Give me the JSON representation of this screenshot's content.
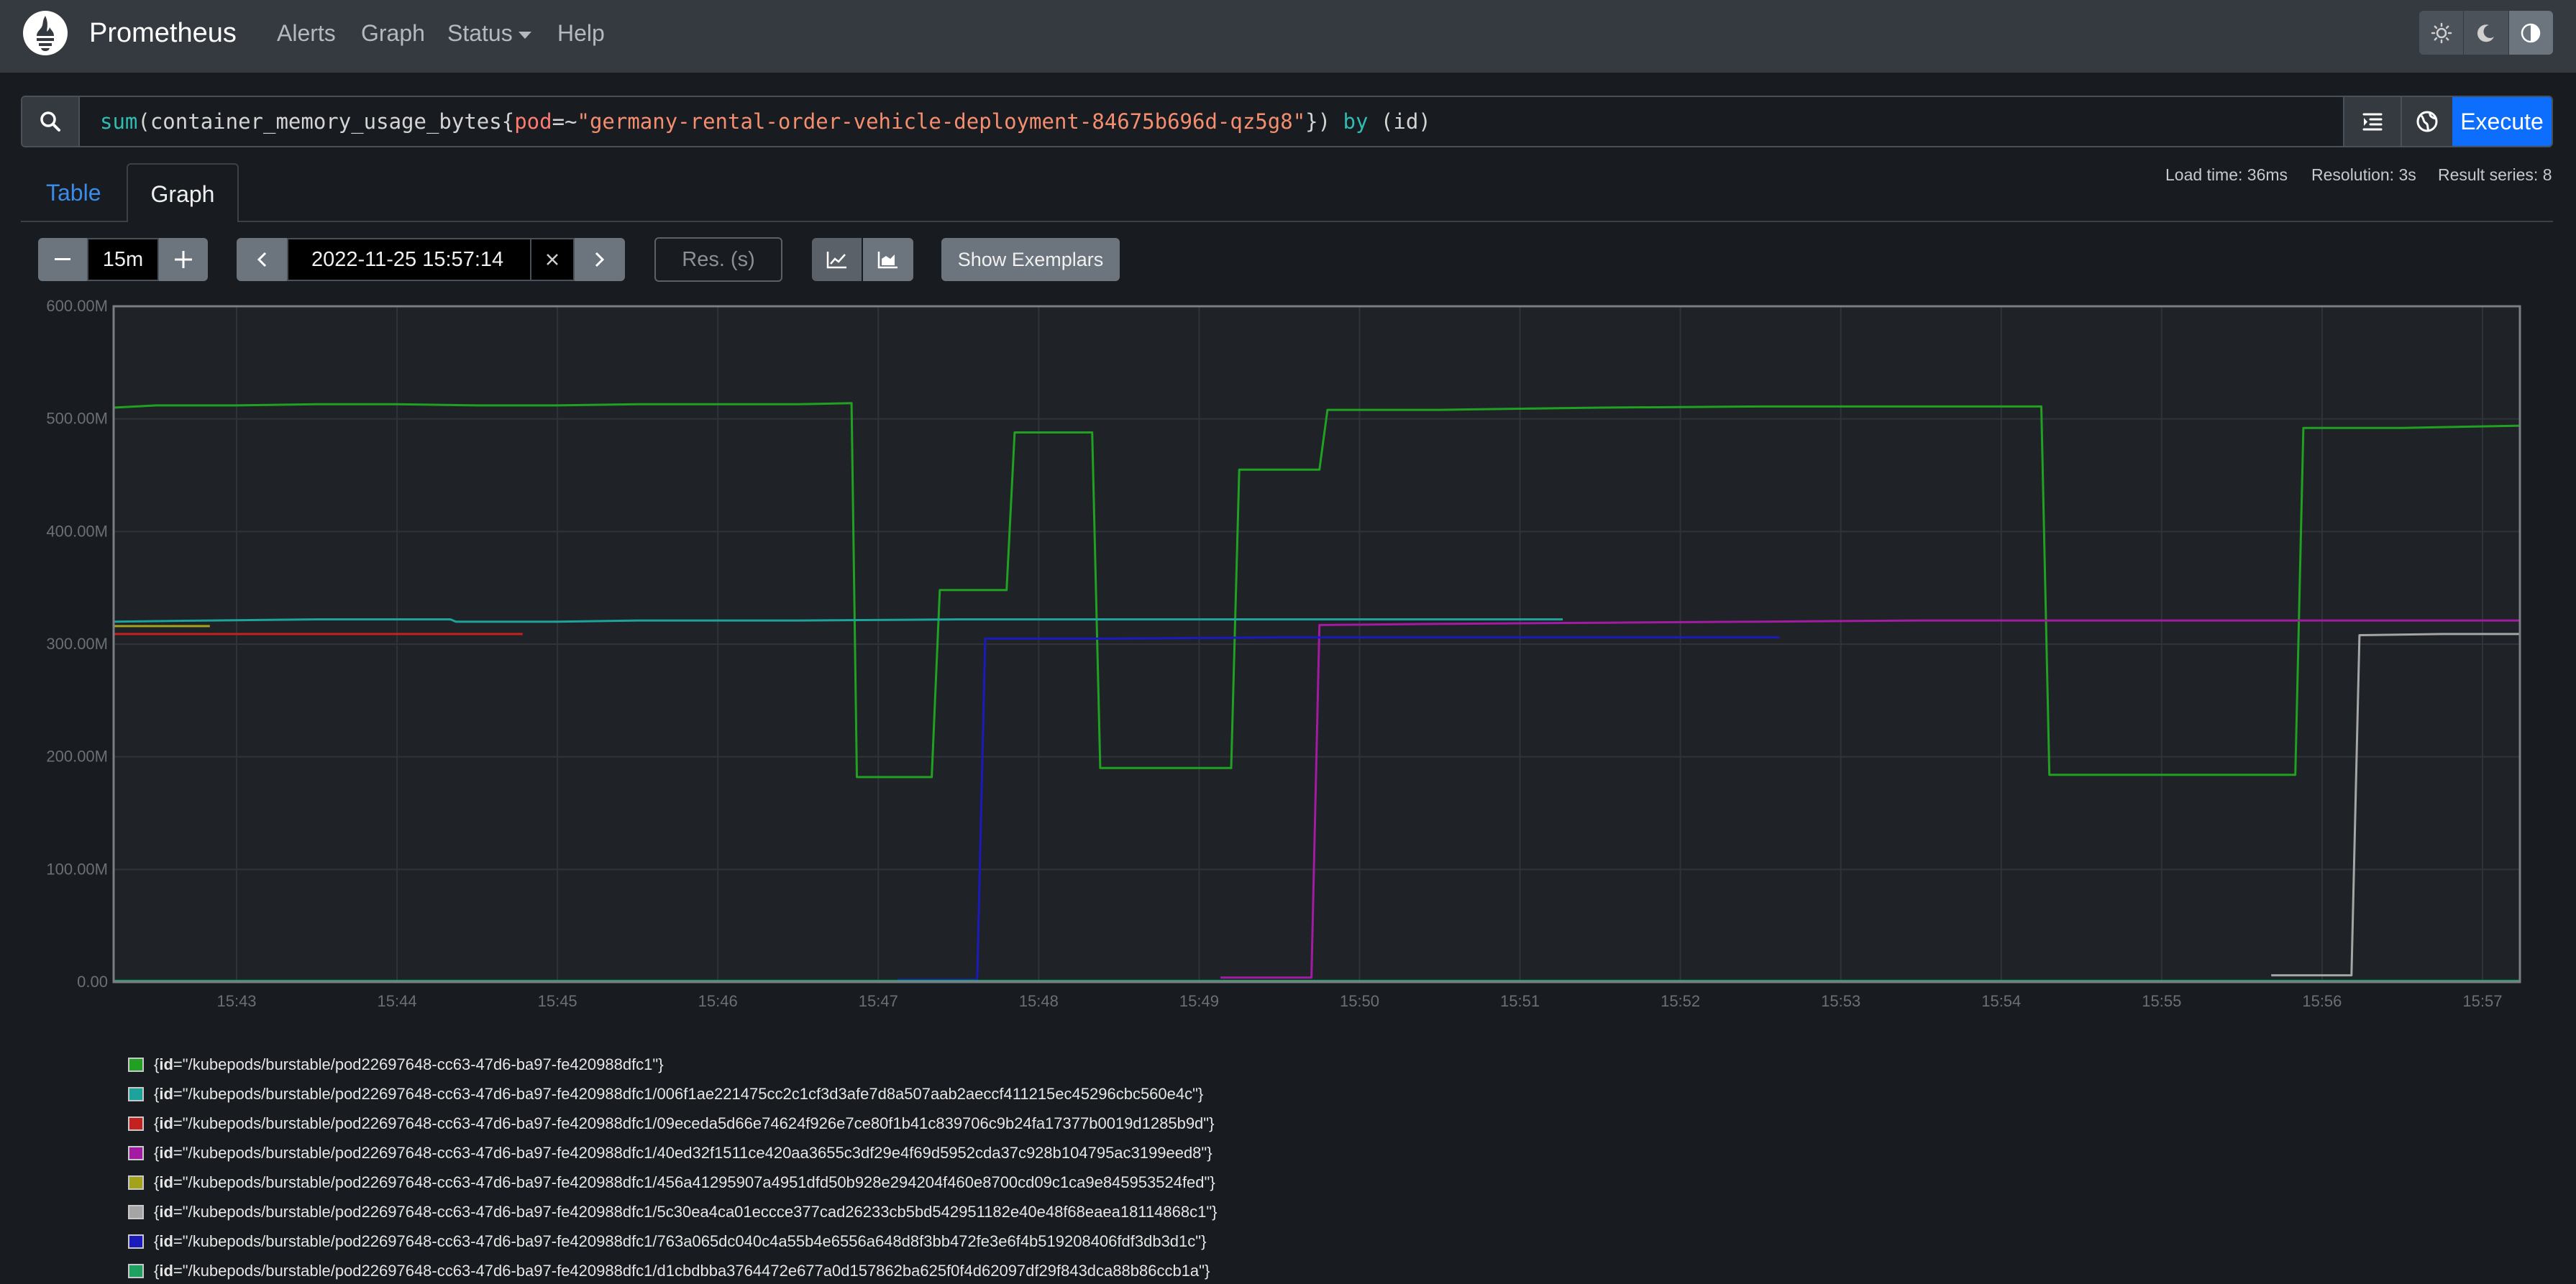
{
  "navbar": {
    "brand": "Prometheus",
    "links": [
      "Alerts",
      "Graph",
      "Status",
      "Help"
    ]
  },
  "query": {
    "expression": "sum(container_memory_usage_bytes{pod=~\"germany-rental-order-vehicle-deployment-84675b696d-qz5g8\"}) by (id)",
    "tokens": {
      "fn": "sum",
      "p1": "(container_memory_usage_bytes{",
      "label": "pod",
      "op": "=~",
      "str": "\"germany-rental-order-vehicle-deployment-84675b696d-qz5g8\"",
      "p2": "}) ",
      "kw": "by",
      "p3": " (id)"
    },
    "execute_label": "Execute"
  },
  "tabs": {
    "table": "Table",
    "graph": "Graph"
  },
  "stats": {
    "load_time": "Load time: 36ms",
    "resolution": "Resolution: 3s",
    "result_series": "Result series: 8"
  },
  "controls": {
    "range": "15m",
    "end_time": "2022-11-25 15:57:14",
    "resolution_placeholder": "Res. (s)",
    "exemplars_label": "Show Exemplars"
  },
  "icons": {
    "theme": [
      "sun-icon",
      "moon-icon",
      "contrast-icon"
    ],
    "query": [
      "search-icon",
      "format-icon",
      "globe-icon"
    ],
    "controls": [
      "minus-icon",
      "plus-icon",
      "chevron-left-icon",
      "close-icon",
      "chevron-right-icon",
      "line-chart-icon",
      "stacked-chart-icon"
    ]
  },
  "chart_data": {
    "type": "line",
    "ylabel": "",
    "xlabel": "",
    "y_ticks": [
      "0.00",
      "100.00M",
      "200.00M",
      "300.00M",
      "400.00M",
      "500.00M",
      "600.00M"
    ],
    "ylim": [
      0,
      600
    ],
    "y_unit": "M",
    "x_ticks": [
      "15:43",
      "15:44",
      "15:45",
      "15:46",
      "15:47",
      "15:48",
      "15:49",
      "15:50",
      "15:51",
      "15:52",
      "15:53",
      "15:54",
      "15:55",
      "15:56",
      "15:57"
    ],
    "xlim": [
      "15:42:14",
      "15:57:14"
    ],
    "grid": true,
    "series": [
      {
        "name": "{id=\"/kubepods/burstable/pod22697648-cc63-47d6-ba97-fe420988dfc1\"}",
        "color": "#21a121",
        "points": [
          [
            "15:42:14",
            510
          ],
          [
            "15:42:30",
            512
          ],
          [
            "15:43:00",
            512
          ],
          [
            "15:43:30",
            513
          ],
          [
            "15:44:00",
            513
          ],
          [
            "15:44:30",
            512
          ],
          [
            "15:45:00",
            512
          ],
          [
            "15:45:30",
            513
          ],
          [
            "15:46:00",
            513
          ],
          [
            "15:46:30",
            513
          ],
          [
            "15:46:50",
            514
          ],
          [
            "15:46:52",
            182
          ],
          [
            "15:47:20",
            182
          ],
          [
            "15:47:23",
            348
          ],
          [
            "15:47:48",
            348
          ],
          [
            "15:47:51",
            488
          ],
          [
            "15:48:20",
            488
          ],
          [
            "15:48:23",
            190
          ],
          [
            "15:49:12",
            190
          ],
          [
            "15:49:15",
            455
          ],
          [
            "15:49:45",
            455
          ],
          [
            "15:49:48",
            508
          ],
          [
            "15:50:30",
            508
          ],
          [
            "15:51:30",
            510
          ],
          [
            "15:52:30",
            511
          ],
          [
            "15:53:30",
            511
          ],
          [
            "15:54:15",
            511
          ],
          [
            "15:54:18",
            184
          ],
          [
            "15:55:50",
            184
          ],
          [
            "15:55:53",
            492
          ],
          [
            "15:56:30",
            492
          ],
          [
            "15:57:14",
            494
          ]
        ]
      },
      {
        "name": "{id=\"/kubepods/burstable/pod22697648-cc63-47d6-ba97-fe420988dfc1/006f1ae221475cc2c1cf3d3afe7d8a507aab2aeccf411215ec45296cbc560e4c\"}",
        "color": "#1ba39c",
        "points": [
          [
            "15:42:14",
            320
          ],
          [
            "15:42:50",
            321
          ],
          [
            "15:43:30",
            322
          ],
          [
            "15:44:00",
            322
          ],
          [
            "15:44:20",
            322
          ],
          [
            "15:44:22",
            320
          ],
          [
            "15:45:00",
            320
          ],
          [
            "15:45:30",
            321
          ],
          [
            "15:46:30",
            321
          ],
          [
            "15:47:30",
            322
          ],
          [
            "15:48:30",
            322
          ],
          [
            "15:49:30",
            322
          ],
          [
            "15:50:30",
            322
          ],
          [
            "15:51:16",
            322
          ]
        ]
      },
      {
        "name": "{id=\"/kubepods/burstable/pod22697648-cc63-47d6-ba97-fe420988dfc1/09eceda5d66e74624f926e7ce80f1b41c839706c9b24fa17377b0019d1285b9d\"}",
        "color": "#c42121",
        "points": [
          [
            "15:42:14",
            309
          ],
          [
            "15:44:47",
            309
          ]
        ]
      },
      {
        "name": "{id=\"/kubepods/burstable/pod22697648-cc63-47d6-ba97-fe420988dfc1/40ed32f1511ce420aa3655c3df29e4f69d5952cda37c928b104795ac3199eed8\"}",
        "color": "#a31ba3",
        "points": [
          [
            "15:49:08",
            4
          ],
          [
            "15:49:42",
            4
          ],
          [
            "15:49:45",
            317
          ],
          [
            "15:50:30",
            318
          ],
          [
            "15:51:30",
            319
          ],
          [
            "15:52:30",
            320
          ],
          [
            "15:53:30",
            321
          ],
          [
            "15:54:30",
            321
          ],
          [
            "15:55:30",
            321
          ],
          [
            "15:56:30",
            321
          ],
          [
            "15:57:14",
            321
          ]
        ]
      },
      {
        "name": "{id=\"/kubepods/burstable/pod22697648-cc63-47d6-ba97-fe420988dfc1/456a41295907a4951dfd50b928e294204f460e8700cd09c1ca9e845953524fed\"}",
        "color": "#a3a31b",
        "points": [
          [
            "15:42:14",
            316
          ],
          [
            "15:42:50",
            316
          ]
        ]
      },
      {
        "name": "{id=\"/kubepods/burstable/pod22697648-cc63-47d6-ba97-fe420988dfc1/5c30ea4ca01eccce377cad26233cb5bd542951182e40e48f68eaea18114868c1\"}",
        "color": "#a5a5a5",
        "points": [
          [
            "15:55:41",
            6
          ],
          [
            "15:56:11",
            6
          ],
          [
            "15:56:14",
            308
          ],
          [
            "15:56:45",
            309
          ],
          [
            "15:57:14",
            309
          ]
        ]
      },
      {
        "name": "{id=\"/kubepods/burstable/pod22697648-cc63-47d6-ba97-fe420988dfc1/763a065dc040c4a55b4e6556a648d8f3bb472fe3e6f4b519208406fdf3db3d1c\"}",
        "color": "#1b1bbd",
        "points": [
          [
            "15:47:07",
            2
          ],
          [
            "15:47:37",
            2
          ],
          [
            "15:47:40",
            305
          ],
          [
            "15:48:30",
            305
          ],
          [
            "15:49:30",
            306
          ],
          [
            "15:50:30",
            306
          ],
          [
            "15:51:30",
            306
          ],
          [
            "15:52:37",
            306
          ]
        ]
      },
      {
        "name": "{id=\"/kubepods/burstable/pod22697648-cc63-47d6-ba97-fe420988dfc1/d1cbdbba3764472e677a0d157862ba625f0f4d62097df29f843dca88b86ccb1a\"}",
        "color": "#21a161",
        "points": [
          [
            "15:42:14",
            1
          ],
          [
            "15:57:14",
            1
          ]
        ]
      }
    ]
  }
}
